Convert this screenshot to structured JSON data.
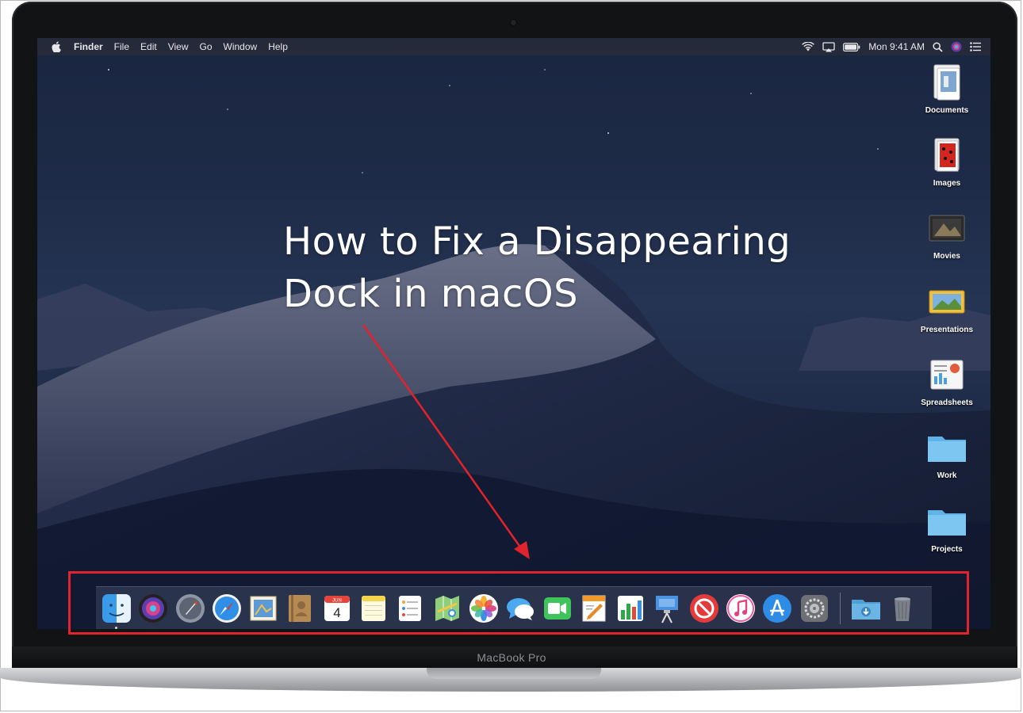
{
  "menubar": {
    "apple_icon": "apple-logo-icon",
    "app_name": "Finder",
    "items": [
      "File",
      "Edit",
      "View",
      "Go",
      "Window",
      "Help"
    ],
    "status_icons": [
      "wifi-icon",
      "airplay-icon",
      "battery-icon"
    ],
    "clock": "Mon 9:41 AM",
    "right_icons": [
      "spotlight-search-icon",
      "siri-icon",
      "notification-center-icon"
    ]
  },
  "desktop": {
    "icons": [
      {
        "label": "Documents",
        "icon": "documents-stack-icon"
      },
      {
        "label": "Images",
        "icon": "images-stack-icon"
      },
      {
        "label": "Movies",
        "icon": "movies-stack-icon"
      },
      {
        "label": "Presentations",
        "icon": "presentations-stack-icon"
      },
      {
        "label": "Spreadsheets",
        "icon": "spreadsheets-stack-icon"
      },
      {
        "label": "Work",
        "icon": "folder-icon"
      },
      {
        "label": "Projects",
        "icon": "folder-icon"
      }
    ]
  },
  "headline": {
    "line1": "How to Fix a Disappearing",
    "line2": "Dock in macOS"
  },
  "calendar": {
    "month": "JUN",
    "day": "4"
  },
  "dock": {
    "apps": [
      "finder-icon",
      "siri-icon",
      "launchpad-icon",
      "safari-icon",
      "mail-icon",
      "contacts-icon",
      "calendar-icon",
      "notes-icon",
      "reminders-icon",
      "maps-icon",
      "photos-icon",
      "messages-icon",
      "facetime-icon",
      "pages-icon",
      "numbers-icon",
      "keynote-icon",
      "news-icon",
      "itunes-icon",
      "app-store-icon",
      "system-preferences-icon"
    ],
    "extras": [
      "downloads-folder-icon",
      "trash-icon"
    ]
  },
  "laptop": {
    "model": "MacBook Pro"
  },
  "annotation": {
    "color": "#e0232c"
  }
}
